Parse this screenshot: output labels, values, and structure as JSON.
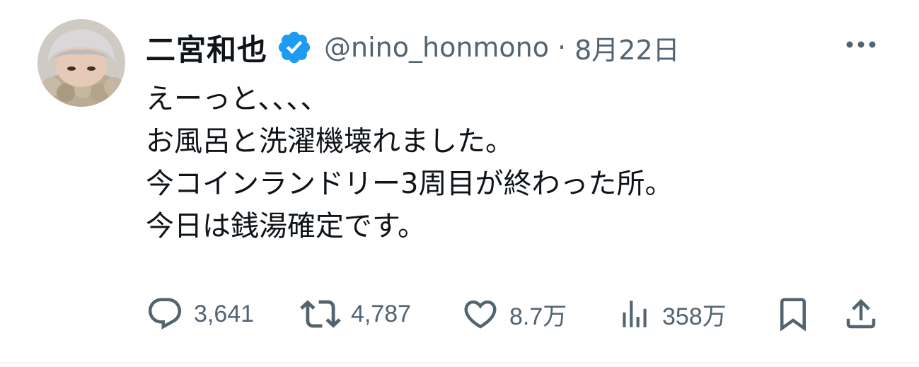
{
  "tweet": {
    "author": {
      "display_name": "二宮和也",
      "handle": "@nino_honmono",
      "verified": true
    },
    "separator": "·",
    "date": "8月22日",
    "lines": [
      "えーっと、、、、",
      "お風呂と洗濯機壊れました。",
      "今コインランドリー3周目が終わった所。",
      "今日は銭湯確定です。"
    ],
    "metrics": {
      "replies": "3,641",
      "reposts": "4,787",
      "likes": "8.7万",
      "views": "358万"
    }
  },
  "icons": {
    "verified": "verified-badge-icon",
    "more": "more-dots-icon",
    "reply": "reply-bubble-icon",
    "repost": "repost-icon",
    "like": "heart-icon",
    "views": "views-chart-icon",
    "bookmark": "bookmark-icon",
    "share": "share-upload-icon"
  },
  "colors": {
    "text": "#0f1419",
    "secondary": "#536471",
    "verified": "#1d9bf0"
  }
}
